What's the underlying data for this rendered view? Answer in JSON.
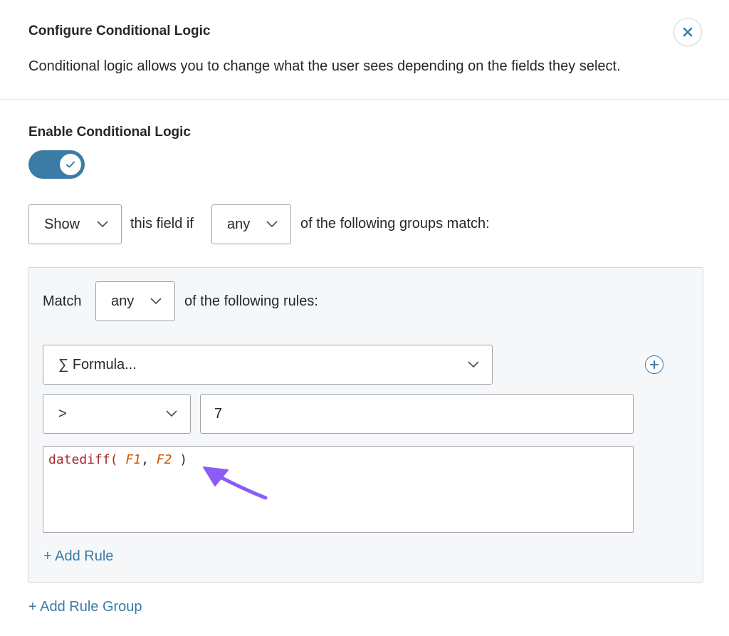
{
  "modal": {
    "title": "Configure Conditional Logic",
    "description": "Conditional logic allows you to change what the user sees depending on the fields they select."
  },
  "enable": {
    "label": "Enable Conditional Logic",
    "enabled": true
  },
  "action_row": {
    "action_value": "Show",
    "text_middle": "this field if",
    "match_value": "any",
    "text_end": "of the following groups match:"
  },
  "group": {
    "match_label": "Match",
    "match_value": "any",
    "match_text_end": "of the following rules:",
    "rule": {
      "field_value": "∑ Formula...",
      "operator_value": ">",
      "compare_value": "7",
      "formula": {
        "fn": "datediff(",
        "space1": " ",
        "var1": "F1",
        "comma": ",",
        "space2": " ",
        "var2": "F2",
        "close": " )"
      }
    },
    "add_rule_label": "+ Add Rule"
  },
  "add_rule_group_label": "+ Add Rule Group",
  "colors": {
    "accent": "#3a7ca5",
    "arrow": "#8b5cf6",
    "formula_fn": "#a8262b",
    "formula_var": "#d35400"
  },
  "icons": {
    "close": "close-icon",
    "toggle_check": "check-icon",
    "dropdown": "chevron-down-icon",
    "add": "plus-circle-icon",
    "annotation": "arrow-icon"
  }
}
